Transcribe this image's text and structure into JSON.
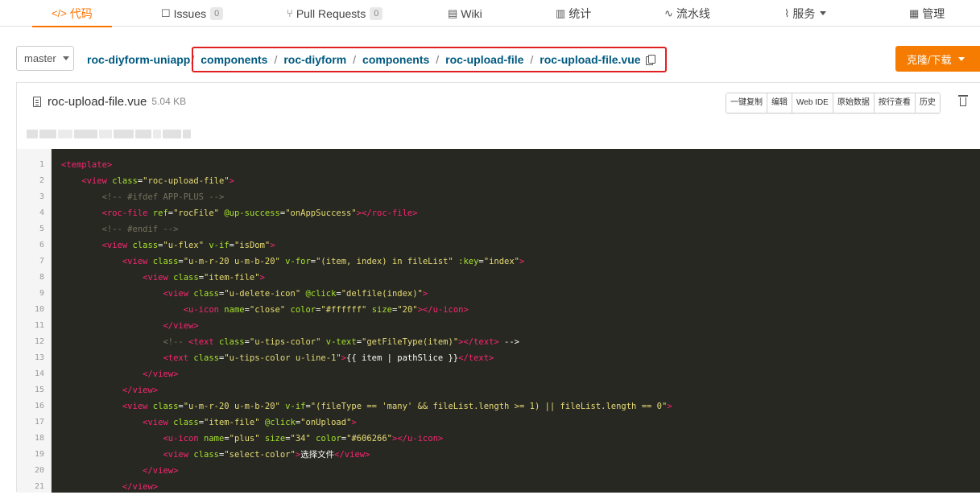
{
  "nav": {
    "tabs": [
      {
        "label": "代码",
        "icon": "</>",
        "icon_name": "code-icon"
      },
      {
        "label": "Issues",
        "icon": "☐",
        "icon_name": "issues-icon",
        "count": "0"
      },
      {
        "label": "Pull Requests",
        "icon": "⑂",
        "icon_name": "pull-request-icon",
        "count": "0"
      },
      {
        "label": "Wiki",
        "icon": "▤",
        "icon_name": "wiki-icon"
      },
      {
        "label": "统计",
        "icon": "▥",
        "icon_name": "stats-icon"
      },
      {
        "label": "流水线",
        "icon": "∿",
        "icon_name": "pipeline-icon"
      },
      {
        "label": "服务",
        "icon": "⌇",
        "icon_name": "service-icon"
      },
      {
        "label": "管理",
        "icon": "▦",
        "icon_name": "manage-icon"
      }
    ],
    "accent": "#fe7300"
  },
  "branch": {
    "selected": "master"
  },
  "breadcrumb": [
    "roc-diyform-uniapp",
    "components",
    "roc-diyform",
    "components",
    "roc-upload-file",
    "roc-upload-file.vue"
  ],
  "clone_button": {
    "label": "克隆/下载",
    "color": "#f57c00"
  },
  "file": {
    "name": "roc-upload-file.vue",
    "size": "5.04 KB",
    "actions": [
      "一键复制",
      "编辑",
      "Web IDE",
      "原始数据",
      "按行查看",
      "历史"
    ]
  },
  "code": {
    "line_numbers": [
      "1",
      "2",
      "3",
      "4",
      "5",
      "6",
      "7",
      "8",
      "9",
      "10",
      "11",
      "12",
      "13",
      "14",
      "15",
      "16",
      "17",
      "18",
      "19",
      "20",
      "21"
    ],
    "lines": [
      [
        {
          "t": "tg",
          "v": "<template>"
        }
      ],
      [
        {
          "t": "tx",
          "v": "    "
        },
        {
          "t": "tg",
          "v": "<view "
        },
        {
          "t": "at",
          "v": "class"
        },
        {
          "t": "tx",
          "v": "="
        },
        {
          "t": "st",
          "v": "\"roc-upload-file\""
        },
        {
          "t": "tg",
          "v": ">"
        }
      ],
      [
        {
          "t": "tx",
          "v": "        "
        },
        {
          "t": "cm",
          "v": "<!-- #ifdef APP-PLUS -->"
        }
      ],
      [
        {
          "t": "tx",
          "v": "        "
        },
        {
          "t": "tg",
          "v": "<roc-file "
        },
        {
          "t": "at",
          "v": "ref"
        },
        {
          "t": "tx",
          "v": "="
        },
        {
          "t": "st",
          "v": "\"rocFile\""
        },
        {
          "t": "tx",
          "v": " "
        },
        {
          "t": "at",
          "v": "@up-success"
        },
        {
          "t": "tx",
          "v": "="
        },
        {
          "t": "st",
          "v": "\"onAppSuccess\""
        },
        {
          "t": "tg",
          "v": "></roc-file>"
        }
      ],
      [
        {
          "t": "tx",
          "v": "        "
        },
        {
          "t": "cm",
          "v": "<!-- #endif -->"
        }
      ],
      [
        {
          "t": "tx",
          "v": "        "
        },
        {
          "t": "tg",
          "v": "<view "
        },
        {
          "t": "at",
          "v": "class"
        },
        {
          "t": "tx",
          "v": "="
        },
        {
          "t": "st",
          "v": "\"u-flex\""
        },
        {
          "t": "tx",
          "v": " "
        },
        {
          "t": "at",
          "v": "v-if"
        },
        {
          "t": "tx",
          "v": "="
        },
        {
          "t": "st",
          "v": "\"isDom\""
        },
        {
          "t": "tg",
          "v": ">"
        }
      ],
      [
        {
          "t": "tx",
          "v": "            "
        },
        {
          "t": "tg",
          "v": "<view "
        },
        {
          "t": "at",
          "v": "class"
        },
        {
          "t": "tx",
          "v": "="
        },
        {
          "t": "st",
          "v": "\"u-m-r-20 u-m-b-20\""
        },
        {
          "t": "tx",
          "v": " "
        },
        {
          "t": "at",
          "v": "v-for"
        },
        {
          "t": "tx",
          "v": "="
        },
        {
          "t": "st",
          "v": "\"(item, index) in fileList\""
        },
        {
          "t": "tx",
          "v": " "
        },
        {
          "t": "at",
          "v": ":key"
        },
        {
          "t": "tx",
          "v": "="
        },
        {
          "t": "st",
          "v": "\"index\""
        },
        {
          "t": "tg",
          "v": ">"
        }
      ],
      [
        {
          "t": "tx",
          "v": "                "
        },
        {
          "t": "tg",
          "v": "<view "
        },
        {
          "t": "at",
          "v": "class"
        },
        {
          "t": "tx",
          "v": "="
        },
        {
          "t": "st",
          "v": "\"item-file\""
        },
        {
          "t": "tg",
          "v": ">"
        }
      ],
      [
        {
          "t": "tx",
          "v": "                    "
        },
        {
          "t": "tg",
          "v": "<view "
        },
        {
          "t": "at",
          "v": "class"
        },
        {
          "t": "tx",
          "v": "="
        },
        {
          "t": "st",
          "v": "\"u-delete-icon\""
        },
        {
          "t": "tx",
          "v": " "
        },
        {
          "t": "at",
          "v": "@click"
        },
        {
          "t": "tx",
          "v": "="
        },
        {
          "t": "st",
          "v": "\"delfile(index)\""
        },
        {
          "t": "tg",
          "v": ">"
        }
      ],
      [
        {
          "t": "tx",
          "v": "                        "
        },
        {
          "t": "tg",
          "v": "<u-icon "
        },
        {
          "t": "at",
          "v": "name"
        },
        {
          "t": "tx",
          "v": "="
        },
        {
          "t": "st",
          "v": "\"close\""
        },
        {
          "t": "tx",
          "v": " "
        },
        {
          "t": "at",
          "v": "color"
        },
        {
          "t": "tx",
          "v": "="
        },
        {
          "t": "st",
          "v": "\"#ffffff\""
        },
        {
          "t": "tx",
          "v": " "
        },
        {
          "t": "at",
          "v": "size"
        },
        {
          "t": "tx",
          "v": "="
        },
        {
          "t": "st",
          "v": "\"20\""
        },
        {
          "t": "tg",
          "v": "></u-icon>"
        }
      ],
      [
        {
          "t": "tx",
          "v": "                    "
        },
        {
          "t": "tg",
          "v": "</view>"
        }
      ],
      [
        {
          "t": "tx",
          "v": "                    "
        },
        {
          "t": "cm",
          "v": "<!-- "
        },
        {
          "t": "tg",
          "v": "<text "
        },
        {
          "t": "at",
          "v": "class"
        },
        {
          "t": "tx",
          "v": "="
        },
        {
          "t": "st",
          "v": "\"u-tips-color\""
        },
        {
          "t": "tx",
          "v": " "
        },
        {
          "t": "at",
          "v": "v-text"
        },
        {
          "t": "tx",
          "v": "="
        },
        {
          "t": "st",
          "v": "\"getFileType(item)\""
        },
        {
          "t": "tg",
          "v": "></text>"
        },
        {
          "t": "tx",
          "v": " -->"
        }
      ],
      [
        {
          "t": "tx",
          "v": "                    "
        },
        {
          "t": "tg",
          "v": "<text "
        },
        {
          "t": "at",
          "v": "class"
        },
        {
          "t": "tx",
          "v": "="
        },
        {
          "t": "st",
          "v": "\"u-tips-color u-line-1\""
        },
        {
          "t": "tg",
          "v": ">"
        },
        {
          "t": "tx",
          "v": "{{ item | pathSlice }}"
        },
        {
          "t": "tg",
          "v": "</text>"
        }
      ],
      [
        {
          "t": "tx",
          "v": "                "
        },
        {
          "t": "tg",
          "v": "</view>"
        }
      ],
      [
        {
          "t": "tx",
          "v": "            "
        },
        {
          "t": "tg",
          "v": "</view>"
        }
      ],
      [
        {
          "t": "tx",
          "v": "            "
        },
        {
          "t": "tg",
          "v": "<view "
        },
        {
          "t": "at",
          "v": "class"
        },
        {
          "t": "tx",
          "v": "="
        },
        {
          "t": "st",
          "v": "\"u-m-r-20 u-m-b-20\""
        },
        {
          "t": "tx",
          "v": " "
        },
        {
          "t": "at",
          "v": "v-if"
        },
        {
          "t": "tx",
          "v": "="
        },
        {
          "t": "st",
          "v": "\"(fileType == 'many' && fileList.length >= 1) || fileList.length == 0\""
        },
        {
          "t": "tg",
          "v": ">"
        }
      ],
      [
        {
          "t": "tx",
          "v": "                "
        },
        {
          "t": "tg",
          "v": "<view "
        },
        {
          "t": "at",
          "v": "class"
        },
        {
          "t": "tx",
          "v": "="
        },
        {
          "t": "st",
          "v": "\"item-file\""
        },
        {
          "t": "tx",
          "v": " "
        },
        {
          "t": "at",
          "v": "@click"
        },
        {
          "t": "tx",
          "v": "="
        },
        {
          "t": "st",
          "v": "\"onUpload\""
        },
        {
          "t": "tg",
          "v": ">"
        }
      ],
      [
        {
          "t": "tx",
          "v": "                    "
        },
        {
          "t": "tg",
          "v": "<u-icon "
        },
        {
          "t": "at",
          "v": "name"
        },
        {
          "t": "tx",
          "v": "="
        },
        {
          "t": "st",
          "v": "\"plus\""
        },
        {
          "t": "tx",
          "v": " "
        },
        {
          "t": "at",
          "v": "size"
        },
        {
          "t": "tx",
          "v": "="
        },
        {
          "t": "st",
          "v": "\"34\""
        },
        {
          "t": "tx",
          "v": " "
        },
        {
          "t": "at",
          "v": "color"
        },
        {
          "t": "tx",
          "v": "="
        },
        {
          "t": "st",
          "v": "\"#606266\""
        },
        {
          "t": "tg",
          "v": "></u-icon>"
        }
      ],
      [
        {
          "t": "tx",
          "v": "                    "
        },
        {
          "t": "tg",
          "v": "<view "
        },
        {
          "t": "at",
          "v": "class"
        },
        {
          "t": "tx",
          "v": "="
        },
        {
          "t": "st",
          "v": "\"select-color\""
        },
        {
          "t": "tg",
          "v": ">"
        },
        {
          "t": "tx",
          "v": "选择文件"
        },
        {
          "t": "tg",
          "v": "</view>"
        }
      ],
      [
        {
          "t": "tx",
          "v": "                "
        },
        {
          "t": "tg",
          "v": "</view>"
        }
      ],
      [
        {
          "t": "tx",
          "v": "            "
        },
        {
          "t": "tg",
          "v": "</view>"
        }
      ]
    ]
  }
}
